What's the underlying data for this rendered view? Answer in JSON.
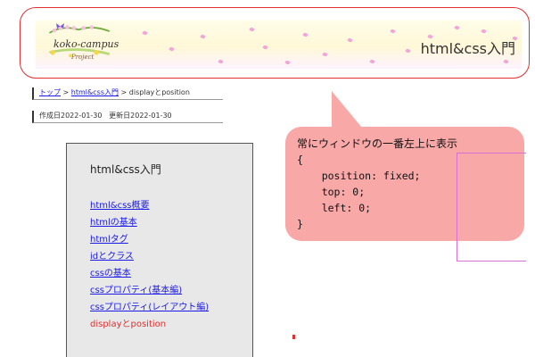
{
  "header": {
    "site_title": "html&css入門",
    "logo_text": "koko-campus",
    "logo_sub": "Project"
  },
  "breadcrumb": {
    "home": "トップ",
    "sep1": ">",
    "section": "html&css入門",
    "sep2": ">",
    "current": "displayとposition"
  },
  "dates": {
    "created": "作成日2022-01-30",
    "updated": "更新日2022-01-30"
  },
  "sidebar": {
    "title": "html&css入門",
    "items": [
      {
        "label": "html&css概要"
      },
      {
        "label": "htmlの基本"
      },
      {
        "label": "htmlタグ"
      },
      {
        "label": "idとクラス"
      },
      {
        "label": "cssの基本"
      },
      {
        "label": "cssプロパティ(基本編)"
      },
      {
        "label": "cssプロパティ(レイアウト編)"
      },
      {
        "label": "displayとposition"
      }
    ]
  },
  "callout": {
    "heading": "常にウィンドウの一番左上に表示",
    "lines": [
      "{",
      "    position: fixed;",
      "    top: 0;",
      "    left: 0;",
      "}"
    ]
  },
  "colors": {
    "frame": "#e03030",
    "bubble": "#f9a8a8",
    "link": "#1a1ae6",
    "current": "#e03030"
  }
}
